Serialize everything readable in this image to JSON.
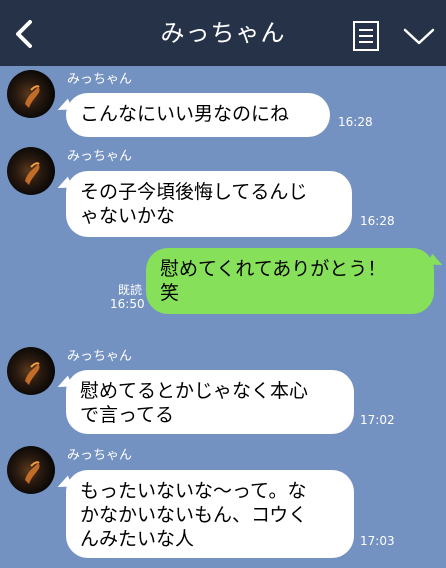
{
  "header": {
    "title": "みっちゃん",
    "back_icon": "chevron-left-icon",
    "menu_icon": "note-list-icon",
    "collapse_icon": "chevron-down-icon"
  },
  "colors": {
    "header_bg": "#263248",
    "chat_bg": "#7391c1",
    "incoming_bubble": "#ffffff",
    "outgoing_bubble": "#86e05a"
  },
  "messages": [
    {
      "direction": "incoming",
      "sender": "みっちゃん",
      "text": "こんなにいい男なのにね",
      "time": "16:28"
    },
    {
      "direction": "incoming",
      "sender": "みっちゃん",
      "text": "その子今頃後悔してるんじ\nゃないかな",
      "time": "16:28"
    },
    {
      "direction": "outgoing",
      "read_status": "既読",
      "text": "慰めてくれてありがとう！\n笑",
      "time": "16:50"
    },
    {
      "direction": "incoming",
      "sender": "みっちゃん",
      "text": "慰めてるとかじゃなく本心\nで言ってる",
      "time": "17:02"
    },
    {
      "direction": "incoming",
      "sender": "みっちゃん",
      "text": "もったいないな〜って。な\nかなかいないもん、コウく\nんみたいな人",
      "time": "17:03"
    }
  ]
}
